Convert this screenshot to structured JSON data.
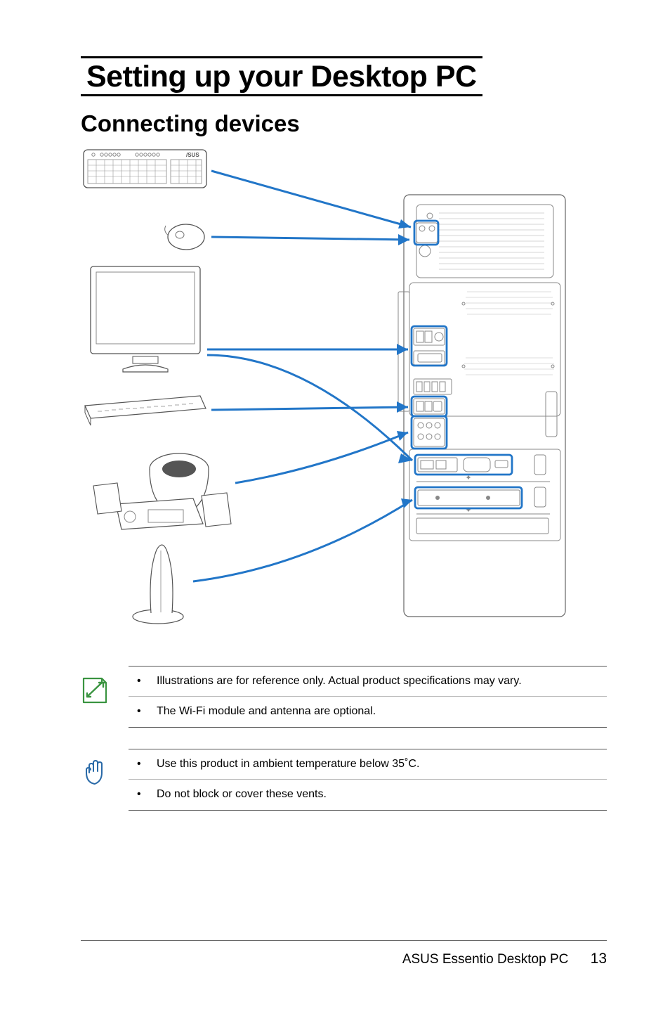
{
  "chapter_title": "Setting up your Desktop PC",
  "section_title": "Connecting devices",
  "note1": {
    "icon": "note-icon",
    "items": [
      "Illustrations are for reference only. Actual product specifications may vary.",
      "The Wi-Fi module and antenna are optional."
    ]
  },
  "note2": {
    "icon": "caution-icon",
    "items": [
      "Use this product in ambient temperature below 35˚C.",
      "Do not block or cover these vents."
    ]
  },
  "footer": {
    "product": "ASUS Essentio Desktop PC",
    "page": "13"
  },
  "colors": {
    "arrow": "#2276c8",
    "highlight": "#2276c8"
  }
}
